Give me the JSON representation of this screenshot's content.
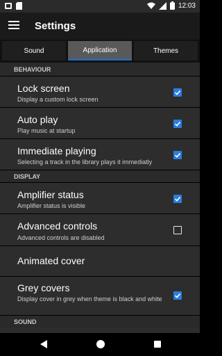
{
  "status_bar": {
    "time": "12:03"
  },
  "app_bar": {
    "title": "Settings"
  },
  "tabs": [
    {
      "label": "Sound",
      "active": false
    },
    {
      "label": "Application",
      "active": true
    },
    {
      "label": "Themes",
      "active": false
    }
  ],
  "sections": {
    "behaviour": {
      "title": "BEHAVIOUR"
    },
    "display": {
      "title": "DISPLAY"
    },
    "sound": {
      "title": "SOUND"
    }
  },
  "settings": {
    "lock_screen": {
      "title": "Lock screen",
      "summary": "Display a custom lock screen",
      "checked": true
    },
    "auto_play": {
      "title": "Auto play",
      "summary": "Play music at startup",
      "checked": true
    },
    "immediate_playing": {
      "title": "Immediate playing",
      "summary": "Selecting a track in the library plays it immediatly",
      "checked": true
    },
    "amplifier_status": {
      "title": "Amplifier status",
      "summary": "Amplifier status is visible",
      "checked": true
    },
    "advanced_controls": {
      "title": "Advanced controls",
      "summary": "Advanced controls are disabled",
      "checked": false
    },
    "animated_cover": {
      "title": "Animated cover"
    },
    "grey_covers": {
      "title": "Grey covers",
      "summary": "Display cover in grey when theme is black and white",
      "checked": true
    }
  },
  "colors": {
    "accent": "#2a7de1",
    "background": "#2d2d2d",
    "app_bar": "#1a1a1a"
  }
}
